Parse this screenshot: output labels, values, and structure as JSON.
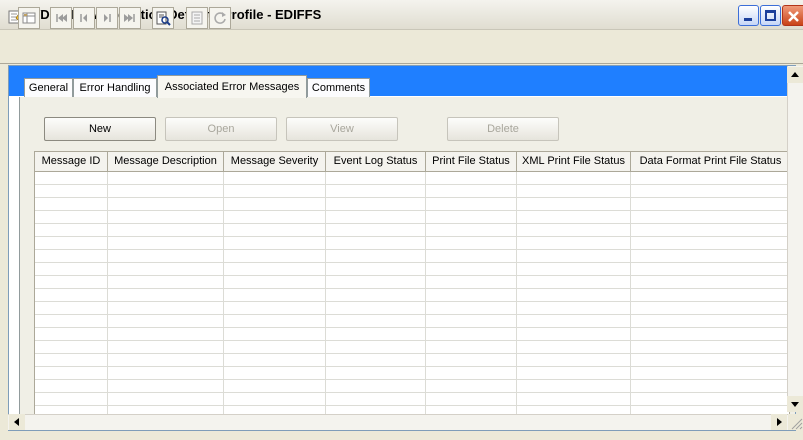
{
  "window": {
    "title": "WDIPHIL - Application Defaults Profile - EDIFFS",
    "icons": [
      "notepad-pencil-icon",
      "minimize-icon",
      "maximize-icon",
      "close-icon"
    ]
  },
  "toolbar": {
    "icons": [
      "table-icon",
      "first-record-icon",
      "previous-record-icon",
      "next-record-icon",
      "last-record-icon",
      "print-preview-icon",
      "list-icon",
      "refresh-icon"
    ]
  },
  "tabs": [
    {
      "label": "General"
    },
    {
      "label": "Error Handling"
    },
    {
      "label": "Associated Error Messages",
      "selected": true
    },
    {
      "label": "Comments"
    }
  ],
  "actions": {
    "new_label": "New",
    "open_label": "Open",
    "view_label": "View",
    "delete_label": "Delete"
  },
  "grid": {
    "columns": [
      "Message ID",
      "Message Description",
      "Message Severity",
      "Event Log Status",
      "Print File Status",
      "XML Print File Status",
      "Data Format Print File Status"
    ],
    "rows": []
  },
  "colors": {
    "tab_band": "#1f7fff",
    "window_bg": "#ece9d8"
  }
}
